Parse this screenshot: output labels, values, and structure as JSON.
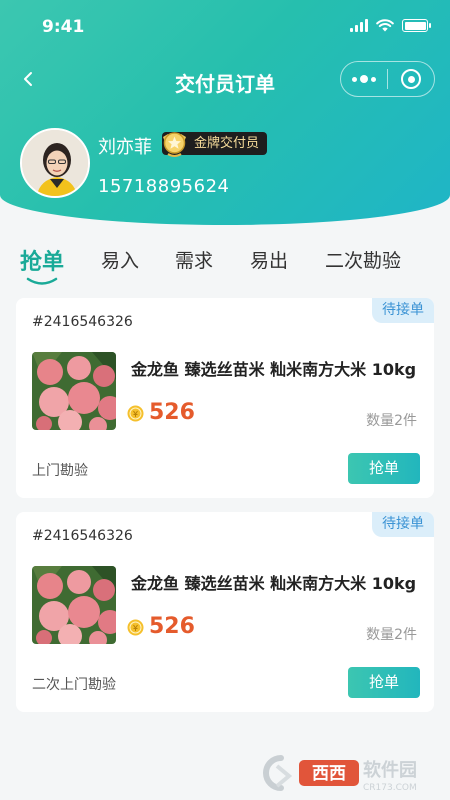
{
  "status_bar": {
    "time": "9:41"
  },
  "nav": {
    "title": "交付员订单",
    "back_icon": "chevron-left-icon"
  },
  "profile": {
    "name": "刘亦菲",
    "badge": "金牌交付员",
    "phone": "15718895624"
  },
  "tabs": [
    {
      "label": "抢单",
      "active": true
    },
    {
      "label": "易入",
      "active": false
    },
    {
      "label": "需求",
      "active": false
    },
    {
      "label": "易出",
      "active": false
    },
    {
      "label": "二次勘验",
      "active": false
    }
  ],
  "orders": [
    {
      "id": "#2416546326",
      "status": "待接单",
      "title": "金龙鱼 臻选丝苗米 籼米南方大米 10kg",
      "price": "526",
      "quantity": "数量2件",
      "service_type": "上门勘验",
      "action": "抢单"
    },
    {
      "id": "#2416546326",
      "status": "待接单",
      "title": "金龙鱼 臻选丝苗米 籼米南方大米 10kg",
      "price": "526",
      "quantity": "数量2件",
      "service_type": "二次上门勘验",
      "action": "抢单"
    }
  ],
  "watermark": {
    "brand": "西西",
    "text": "软件园",
    "url": "CR173.COM"
  },
  "colors": {
    "accent": "#1aaa98",
    "price": "#e55b2c",
    "status_badge_bg": "#dbeefa",
    "status_badge_text": "#3b93d4"
  }
}
